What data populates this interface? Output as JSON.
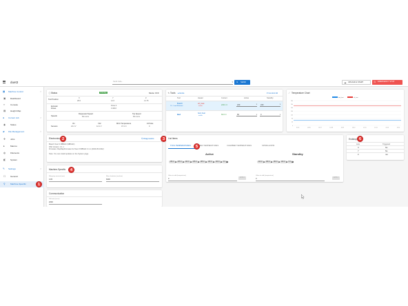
{
  "topbar": {
    "board_name": "duet3",
    "search_placeholder": "Send code...",
    "send_label": "SEND",
    "upload_label": "UPLOAD & START",
    "emergency_label": "EMERGENCY STOP",
    "colors": {
      "primary": "#1976d2",
      "emergency": "#ef5350"
    }
  },
  "sidebar": {
    "categories": [
      {
        "label": "Machine Control",
        "icon": "machine-control-icon",
        "items": [
          {
            "label": "Dashboard",
            "icon": "dashboard-icon"
          },
          {
            "label": "Console",
            "icon": "console-icon"
          },
          {
            "label": "Height Map",
            "icon": "height-map-icon"
          }
        ]
      },
      {
        "label": "Current Job",
        "icon": "current-job-icon",
        "items": [
          {
            "label": "Status",
            "icon": "status-icon"
          }
        ]
      },
      {
        "label": "File Management",
        "icon": "file-management-icon",
        "items": [
          {
            "label": "Jobs",
            "icon": "jobs-icon"
          },
          {
            "label": "Macros",
            "icon": "macros-icon"
          },
          {
            "label": "Filaments",
            "icon": "filaments-icon"
          },
          {
            "label": "System",
            "icon": "system-icon"
          }
        ]
      },
      {
        "label": "Settings",
        "icon": "settings-icon",
        "items": [
          {
            "label": "General",
            "icon": "general-icon"
          },
          {
            "label": "Machine-Specific",
            "icon": "machine-specific-icon"
          }
        ]
      }
    ]
  },
  "status_panel": {
    "title": "Status",
    "state_badge": "Printing",
    "mode": "Mode: FFF",
    "axes": [
      "X",
      "Y",
      "Z"
    ],
    "tool_position_label": "Tool Position",
    "tool_position": [
      "28.0",
      "12.0",
      "14.75"
    ],
    "extruder_drives_label": "Extruder Drives",
    "drive_label": "Drive 0",
    "drive_value": "0.4010",
    "speeds_label": "Speeds",
    "requested_speed_label": "Requested Speed",
    "requested_speed": "50 mm/s",
    "top_speed_label": "Top Speed",
    "top_speed": "50 mm/s",
    "sensors_label": "Sensors",
    "sensor_headers": [
      "Vin",
      "V12",
      "MCU Temperature",
      "Z-Probe"
    ],
    "sensor_values": [
      "24.1 V",
      "12.1 V",
      "47.1 C",
      "0"
    ]
  },
  "tools_panel": {
    "title": "Tools",
    "extra_label": "Extra",
    "control_all_label": "Control All",
    "headers": [
      "Tool",
      "Heater",
      "Current",
      "Active",
      "Standby"
    ],
    "rows": [
      {
        "tool": "Tool 0",
        "sub": "T0 · Load Filament",
        "heater": "e0_heat",
        "heater_sub": "active",
        "current": "220.1 C",
        "active": "220",
        "standby": "220"
      },
      {
        "tool": "Bed",
        "sub": "",
        "heater": "bed_heat",
        "heater_sub": "active",
        "current": "60.0 C",
        "active": "60",
        "standby": "0"
      }
    ]
  },
  "temp_chart": {
    "title": "Temperature Chart",
    "legend": [
      {
        "name": "bed_heat",
        "color": "#1e88e5"
      },
      {
        "name": "e0_heat",
        "color": "#e53935"
      }
    ],
    "x_ticks": [
      "10:05",
      "10:06",
      "10:07",
      "10:08",
      "10:09",
      "10:10",
      "10:11",
      "10:12",
      "10:13",
      "10:14"
    ],
    "y_ticks": [
      "280",
      "240",
      "200",
      "160",
      "120",
      "80",
      "40",
      "0"
    ]
  },
  "electronics": {
    "title": "Electronics",
    "diagnostics_label": "Diagnostics",
    "lines": [
      "Board: Duet 3 MB6HC (MB6HC)",
      "DSF Version: 3.1.1",
      "Firmware: RepRapFirmware for Duet 3 MB6HC 3.1.1 (2020-05-19b2)",
      "Note: You can install updates on the System page."
    ]
  },
  "machine_specific": {
    "title": "Machine-Specific",
    "field1_label": "Babystep amount (mm)",
    "field1_value": "0.05",
    "field2_label": "Move feedrate (mm/min)",
    "field2_value": "6000"
  },
  "communication": {
    "title": "Communication",
    "field_label": "Poll rate (in ms)",
    "field_value": "2000"
  },
  "list_items": {
    "title": "List Items",
    "tabs": [
      "TOOL TEMPERATURES",
      "BED TEMPERATURES",
      "CHAMBER TEMPERATURES",
      "SPINDLE RPM"
    ],
    "active_heading": "Active",
    "standby_heading": "Standby",
    "active_chips": [
      "250 C",
      "235 C",
      "220 C",
      "205 C",
      "195 C",
      "160 C",
      "100 C",
      "0 C"
    ],
    "standby_chips": [
      "210 C",
      "180 C",
      "160 C",
      "140 C",
      "0 C"
    ],
    "input_label": "Value to add (temperature)",
    "input_value": "0",
    "apply_label": "APPLY"
  },
  "endstops": {
    "title": "Endstops",
    "headers": [
      "Axis",
      "Triggered"
    ],
    "rows": [
      [
        "X",
        "No"
      ],
      [
        "Y",
        "No"
      ],
      [
        "Z",
        "n/a"
      ]
    ]
  },
  "callouts": [
    "1",
    "2",
    "3",
    "4",
    "5",
    "6"
  ]
}
